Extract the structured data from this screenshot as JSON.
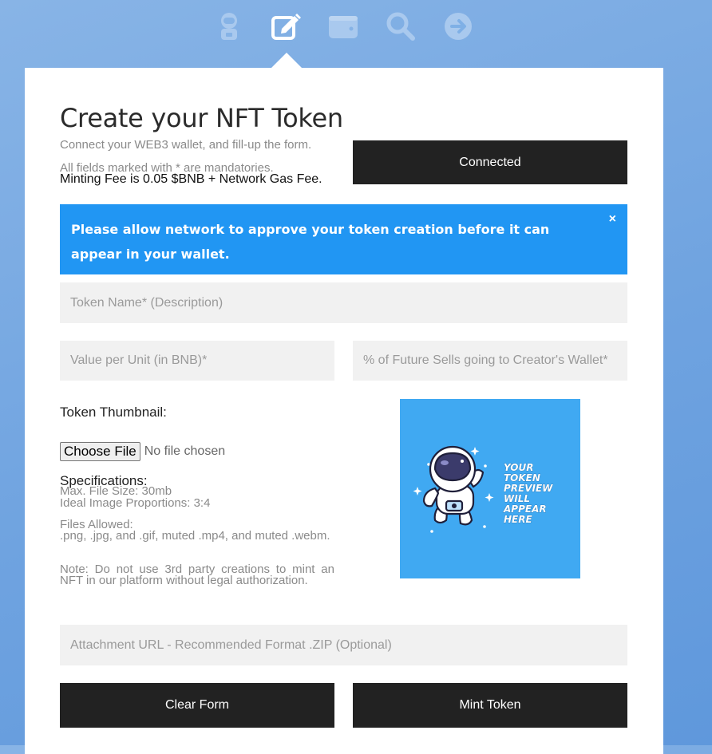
{
  "nav": {
    "icons": [
      "astronaut-icon",
      "edit-icon",
      "wallet-icon",
      "search-icon",
      "arrow-right-circle-icon"
    ],
    "active": "edit-icon"
  },
  "form": {
    "title": "Create your NFT Token",
    "intro_line1": "Connect your WEB3 wallet, and fill-up the form.",
    "intro_line2": "All fields marked with * are mandatories.",
    "fee_text": "Minting Fee is 0.05 $BNB + Network Gas Fee.",
    "connect_button": "Connected",
    "alert": {
      "text": "Please allow network to approve your token creation before it can appear in your wallet.",
      "close": "×"
    },
    "token_name_placeholder": "Token Name* (Description)",
    "value_placeholder": "Value per Unit (in BNB)*",
    "royalty_placeholder": "% of Future Sells going to Creator's Wallet*",
    "thumbnail_label": "Token Thumbnail:",
    "file_button": "Choose File",
    "file_status": "No file chosen",
    "specs": {
      "title": "Specifications:",
      "max_size": "Max. File Size: 30mb",
      "proportions": "Ideal Image Proportions: 3:4",
      "files_allowed_title": "Files Allowed:",
      "files_allowed": ".png, .jpg, and .gif, muted .mp4, and muted .webm.",
      "note": "Note: Do not use 3rd party creations to mint an NFT in our platform without legal authorization."
    },
    "preview_text": [
      "YOUR",
      "TOKEN",
      "PREVIEW",
      "WILL",
      "APPEAR",
      "HERE"
    ],
    "attachment_placeholder": "Attachment URL - Recommended Format .ZIP (Optional)",
    "clear_button": "Clear Form",
    "mint_button": "Mint Token"
  },
  "colors": {
    "background": "#6fa3e0",
    "nav_icon": "#a9c9ee",
    "nav_icon_active": "#ffffff",
    "button": "#222222",
    "alert": "#2196f3",
    "field": "#f1f1f1",
    "preview_bg": "#40a9f2"
  }
}
